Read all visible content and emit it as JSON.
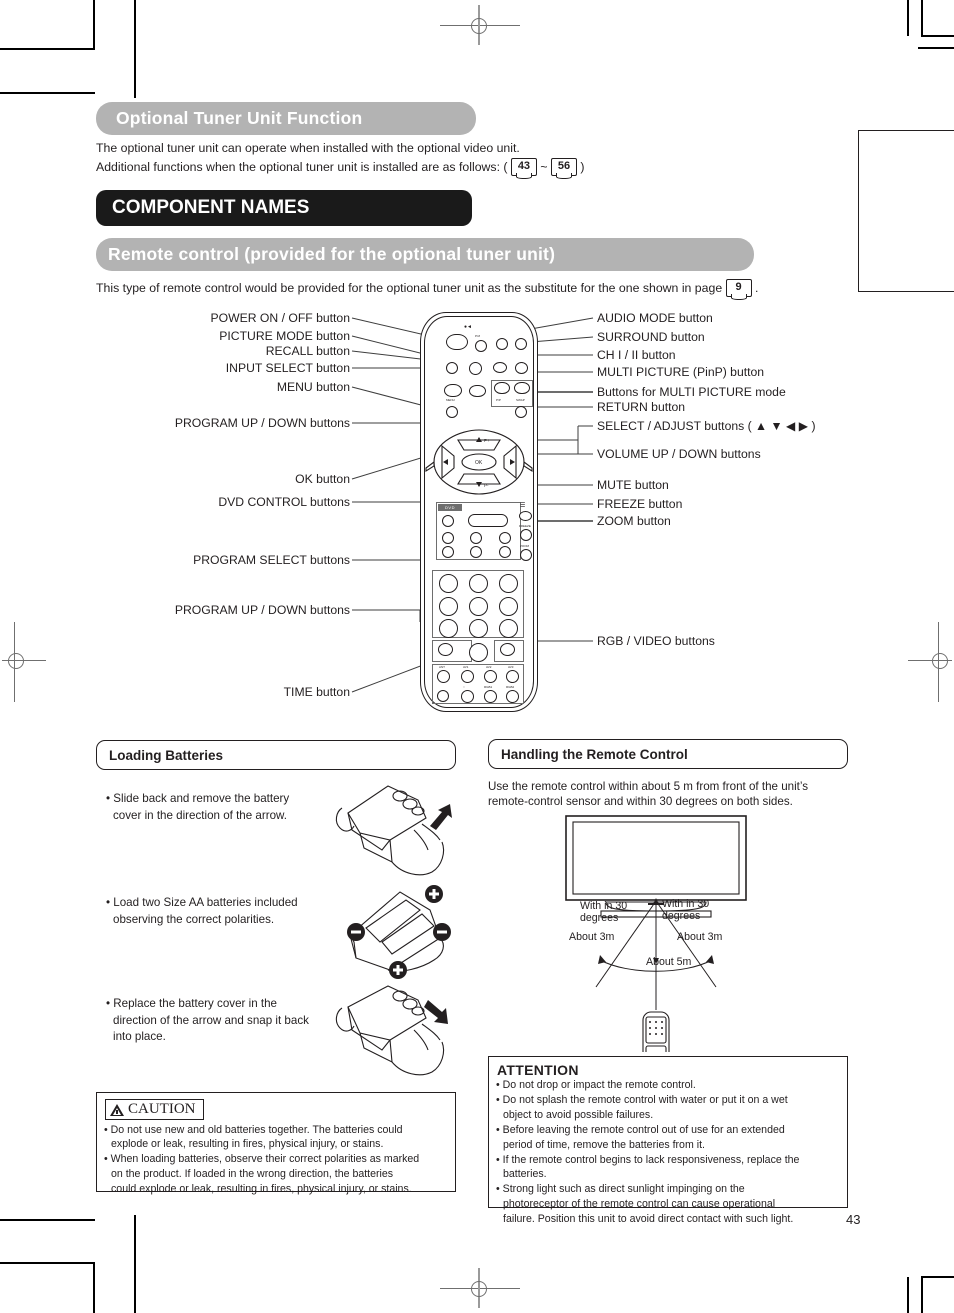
{
  "page": {
    "number": "43"
  },
  "headings": {
    "optional_tuner": "Optional Tuner Unit Function",
    "component_names": "COMPONENT NAMES",
    "remote_control": "Remote control (provided for the optional tuner unit)"
  },
  "intro": {
    "line1": "The optional tuner unit can operate when installed with the optional video unit.",
    "line2_pre": "Additional functions when the optional tuner unit is installed are as follows: (",
    "ref_from": "43",
    "tilde": "~",
    "ref_to": "56",
    "line2_post": ")",
    "remote_note_pre": "This type of remote control would be provided for the optional tuner unit as the substitute for the one shown in page",
    "remote_note_ref": "9",
    "remote_note_post": "."
  },
  "callouts": {
    "left": [
      {
        "label": "POWER ON / OFF button"
      },
      {
        "label": "PICTURE MODE button"
      },
      {
        "label": "RECALL button"
      },
      {
        "label": "INPUT SELECT button"
      },
      {
        "label": "MENU button"
      },
      {
        "label": "PROGRAM UP / DOWN buttons"
      },
      {
        "label": "OK button"
      },
      {
        "label": "DVD CONTROL buttons"
      },
      {
        "label": "PROGRAM SELECT buttons"
      },
      {
        "label": "PROGRAM UP / DOWN buttons"
      },
      {
        "label": "TIME button"
      }
    ],
    "right": [
      {
        "label": "AUDIO MODE button"
      },
      {
        "label": "SURROUND button"
      },
      {
        "label": "CH I / II button"
      },
      {
        "label": "MULTI PICTURE (PinP) button"
      },
      {
        "label": "Buttons for MULTI PICTURE mode"
      },
      {
        "label": "RETURN button"
      },
      {
        "label": "SELECT / ADJUST buttons ( ▲ ▼ ◀ ▶ )"
      },
      {
        "label": "VOLUME UP / DOWN buttons"
      },
      {
        "label": "MUTE button"
      },
      {
        "label": "FREEZE button"
      },
      {
        "label": "ZOOM button"
      },
      {
        "label": "RGB / VIDEO buttons"
      }
    ]
  },
  "remote_legend": {
    "dvd_tab": "DVD",
    "mute": "MUTE",
    "freeze": "FREEZE",
    "zoom": "ZOOM",
    "menu": "MENU",
    "pinp": "PinP",
    "swap": "SWAP",
    "ok": "OK",
    "ant": "ANT",
    "av1": "AV1",
    "av2": "AV2",
    "av3": "AV3",
    "rgb1": "RGB1",
    "rgb2": "RGB2",
    "time": "TIME",
    "prog_up": "P+",
    "prog_down": "P-"
  },
  "loading_batteries": {
    "title": "Loading Batteries",
    "steps": [
      "• Slide back and remove the battery\n   cover in the direction of the arrow.",
      "• Load two Size AA batteries included\n   observing the correct polarities.",
      "• Replace the battery cover in the\n   direction of the arrow and snap it back\n   into place."
    ],
    "step1_l1": "• Slide back and remove the battery",
    "step1_l2": "cover in the direction of the arrow.",
    "step2_l1": "• Load two Size AA batteries included",
    "step2_l2": "observing the correct polarities.",
    "step3_l1": "• Replace the battery cover in the",
    "step3_l2": "direction of the arrow and snap it back",
    "step3_l3": "into place."
  },
  "caution": {
    "title": "CAUTION",
    "l1": "• Do not use new and old batteries together.  The batteries could",
    "l2": "explode or leak, resulting in fires, physical injury, or stains.",
    "l3": "• When loading batteries, observe their correct polarities as marked",
    "l4": "on the product. If loaded in the wrong direction, the batteries",
    "l5": "could explode or leak, resulting in fires, physical injury, or stains."
  },
  "handling": {
    "title": "Handling the Remote Control",
    "desc_l1": "Use the remote control within about 5 m from front of the unit’s",
    "desc_l2": "remote-control sensor and within 30 degrees on both sides.",
    "diagram": {
      "left_angle_l1": "With in 30",
      "left_angle_l2": "degrees",
      "right_angle_l1": "With in 30",
      "right_angle_l2": "degrees",
      "left_dist": "About 3m",
      "right_dist": "About 3m",
      "center_dist": "About 5m"
    }
  },
  "attention": {
    "title": "ATTENTION",
    "l1": "• Do not drop or impact the remote control.",
    "l2": "• Do not splash the remote control with water or put it on a wet",
    "l3": "object to avoid possible failures.",
    "l4": "• Before leaving the remote control out of use for an extended",
    "l5": "period of time, remove the batteries from it.",
    "l6": "• If the remote control begins to lack responsiveness, replace the",
    "l7": "batteries.",
    "l8": "• Strong light such as direct sunlight impinging on the",
    "l9": "photoreceptor of the remote control can cause operational",
    "l10": "failure. Position this unit to avoid direct contact with such light."
  },
  "colors": {
    "grey_banner": "#b3b3b3",
    "black_banner": "#1a1a1a",
    "ink": "#231f20"
  }
}
